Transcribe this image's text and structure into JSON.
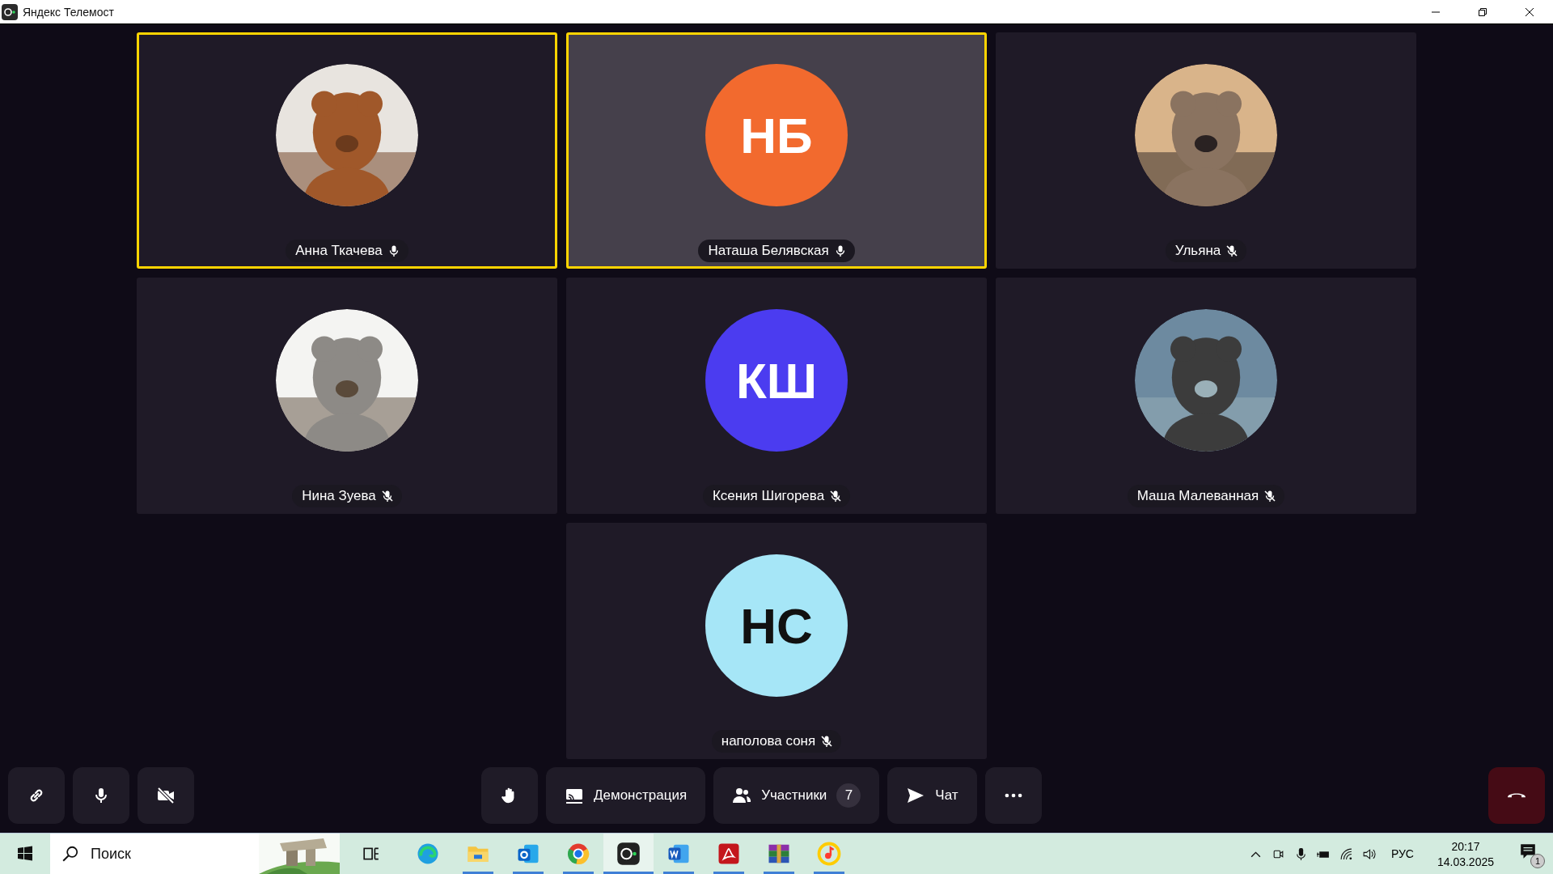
{
  "window": {
    "title": "Яндекс Телемост"
  },
  "participants": [
    {
      "name": "Анна Ткачева",
      "kind": "picture",
      "speaking": true,
      "highlighted": false,
      "muted": false
    },
    {
      "name": "Наташа Белявская",
      "kind": "initials",
      "initials": "НБ",
      "color": "#f26a2e",
      "speaking": true,
      "highlighted": true,
      "muted": false
    },
    {
      "name": "Ульяна",
      "kind": "picture",
      "speaking": false,
      "highlighted": false,
      "muted": true
    },
    {
      "name": "Нина Зуева",
      "kind": "picture",
      "speaking": false,
      "highlighted": false,
      "muted": true
    },
    {
      "name": "Ксения Шигорева",
      "kind": "initials",
      "initials": "КШ",
      "color": "#4b3cf0",
      "speaking": false,
      "highlighted": false,
      "muted": true
    },
    {
      "name": "Маша Малеванная",
      "kind": "picture",
      "speaking": false,
      "highlighted": false,
      "muted": true
    },
    {
      "name": "наполова соня",
      "kind": "initials",
      "initials": "НС",
      "color": "#a6e6f7",
      "speaking": false,
      "highlighted": false,
      "muted": true
    }
  ],
  "toolbar": {
    "demo_label": "Демонстрация",
    "participants_label": "Участники",
    "participants_count": "7",
    "chat_label": "Чат",
    "mic_on": true,
    "camera_on": false
  },
  "taskbar": {
    "search_placeholder": "Поиск",
    "apps": [
      {
        "kind": "edge",
        "open": false,
        "active": false
      },
      {
        "kind": "folder",
        "open": true,
        "active": false
      },
      {
        "kind": "outlook",
        "open": true,
        "active": false
      },
      {
        "kind": "chrome",
        "open": true,
        "active": false
      },
      {
        "kind": "telemost",
        "open": true,
        "active": true
      },
      {
        "kind": "word",
        "open": true,
        "active": false
      },
      {
        "kind": "pdf",
        "open": true,
        "active": false
      },
      {
        "kind": "archive",
        "open": true,
        "active": false
      },
      {
        "kind": "music",
        "open": true,
        "active": false
      }
    ],
    "language": "РУС",
    "time": "20:17",
    "date": "14.03.2025",
    "notifications": "1"
  }
}
